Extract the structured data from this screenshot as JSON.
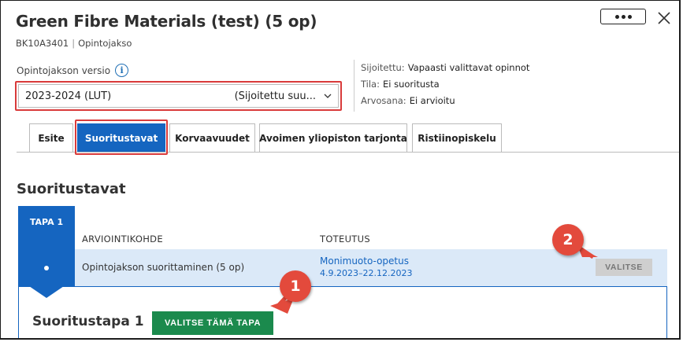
{
  "header": {
    "title": "Green Fibre Materials (test) (5 op)",
    "code": "BK10A3401",
    "type": "Opintojakso"
  },
  "version": {
    "label": "Opintojakson versio",
    "selected_value": "2023-2024 (LUT)",
    "selected_detail": "(Sijoitettu suu..."
  },
  "info": {
    "rows": [
      {
        "key": "Sijoitettu:",
        "value": "Vapaasti valittavat opinnot"
      },
      {
        "key": "Tila:",
        "value": "Ei suoritusta"
      },
      {
        "key": "Arvosana:",
        "value": "Ei arvioitu"
      }
    ]
  },
  "tabs": [
    {
      "label": "Esite",
      "active": false
    },
    {
      "label": "Suoritustavat",
      "active": true
    },
    {
      "label": "Korvaavuudet",
      "active": false
    },
    {
      "label": "Avoimen yliopiston tarjonta",
      "active": false
    },
    {
      "label": "Ristiinopiskelu",
      "active": false
    }
  ],
  "section": {
    "title": "Suoritustavat",
    "tapa_label": "TAPA 1",
    "columns": [
      "ARVIOINTIKOHDE",
      "TOTEUTUS"
    ],
    "rows": [
      {
        "arviointikohde": "Opintojakson suorittaminen (5 op)",
        "toteutus_name": "Monimuoto-opetus",
        "toteutus_dates": "4.9.2023–22.12.2023",
        "select_label": "VALITSE"
      }
    ],
    "detail_title": "Suoritustapa 1",
    "choose_label": "VALITSE TÄMÄ TAPA"
  },
  "annotations": {
    "callout_1": "1",
    "callout_2": "2",
    "highlight_color": "#d93b3b",
    "callout_color": "#e34a3c"
  },
  "colors": {
    "primary": "#1565c0",
    "row_highlight": "#dbe9f8",
    "success": "#1b8a4d"
  },
  "icons": [
    "more-icon",
    "close-icon",
    "info-icon",
    "chevron-down-icon"
  ]
}
